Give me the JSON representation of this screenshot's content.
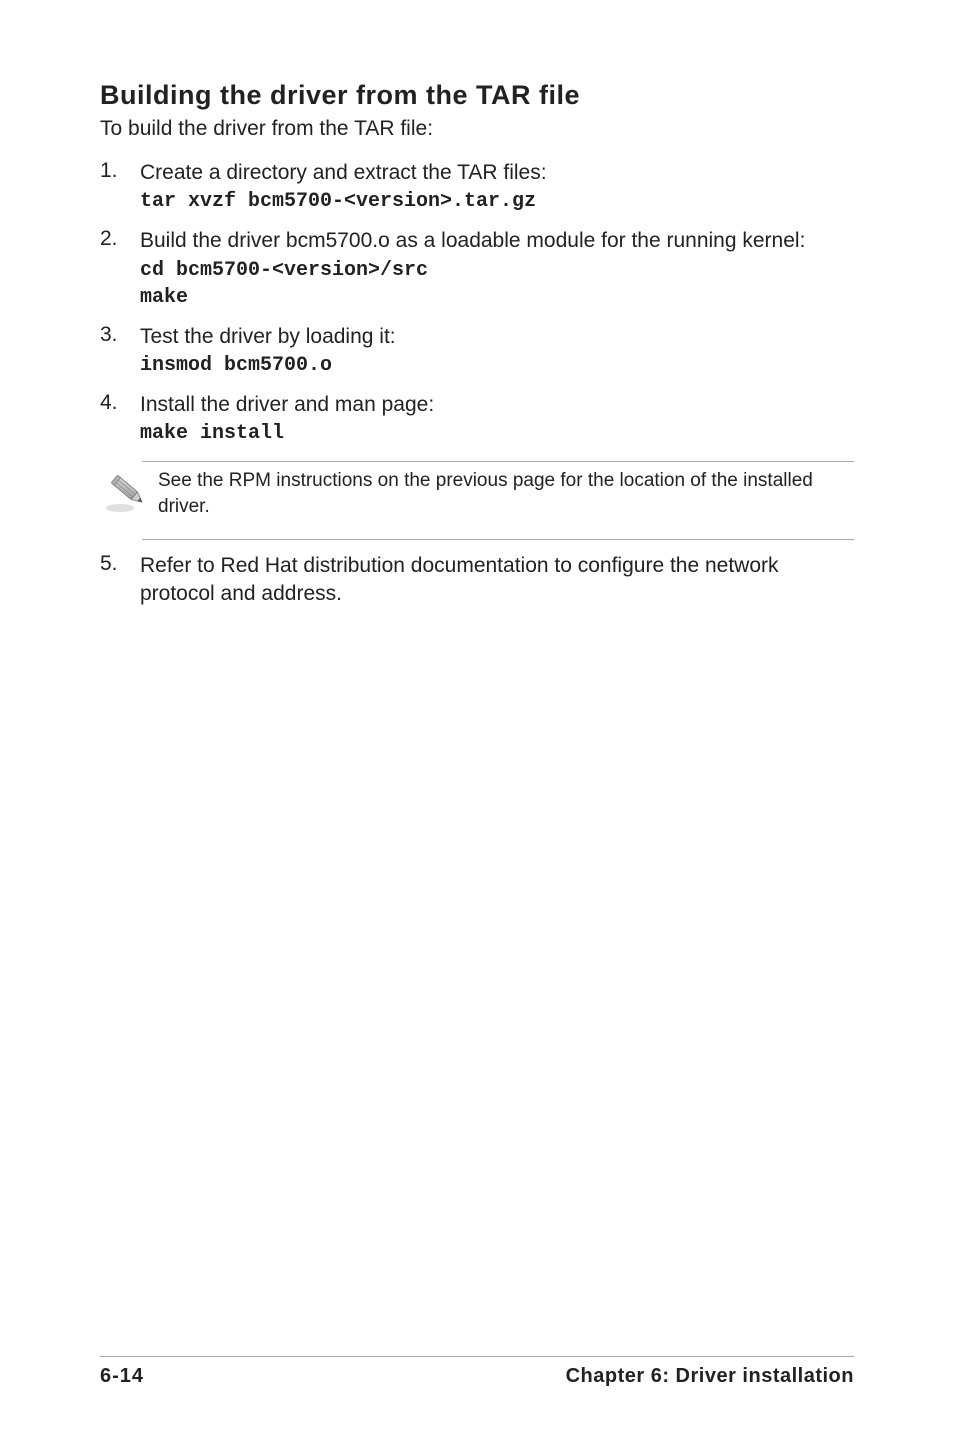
{
  "heading": "Building the driver from the TAR file",
  "intro": "To build the driver from the TAR file:",
  "steps": [
    {
      "num": "1.",
      "text": "Create a directory and extract the TAR files:",
      "cmd": "tar xvzf bcm5700-<version>.tar.gz"
    },
    {
      "num": "2.",
      "text": "Build the driver bcm5700.o as a loadable module for the running kernel:",
      "cmd": "cd bcm5700-<version>/src\nmake"
    },
    {
      "num": "3.",
      "text": "Test the driver by loading it:",
      "cmd": "insmod bcm5700.o"
    },
    {
      "num": "4.",
      "text": "Install the driver and man page:",
      "cmd": "make install"
    }
  ],
  "note": "See the RPM instructions on the previous page for the location of the installed driver.",
  "step5": {
    "num": "5.",
    "text": "Refer to Red Hat distribution documentation to configure the network protocol and address."
  },
  "footer": {
    "page_number": "6-14",
    "chapter": "Chapter 6: Driver installation"
  }
}
